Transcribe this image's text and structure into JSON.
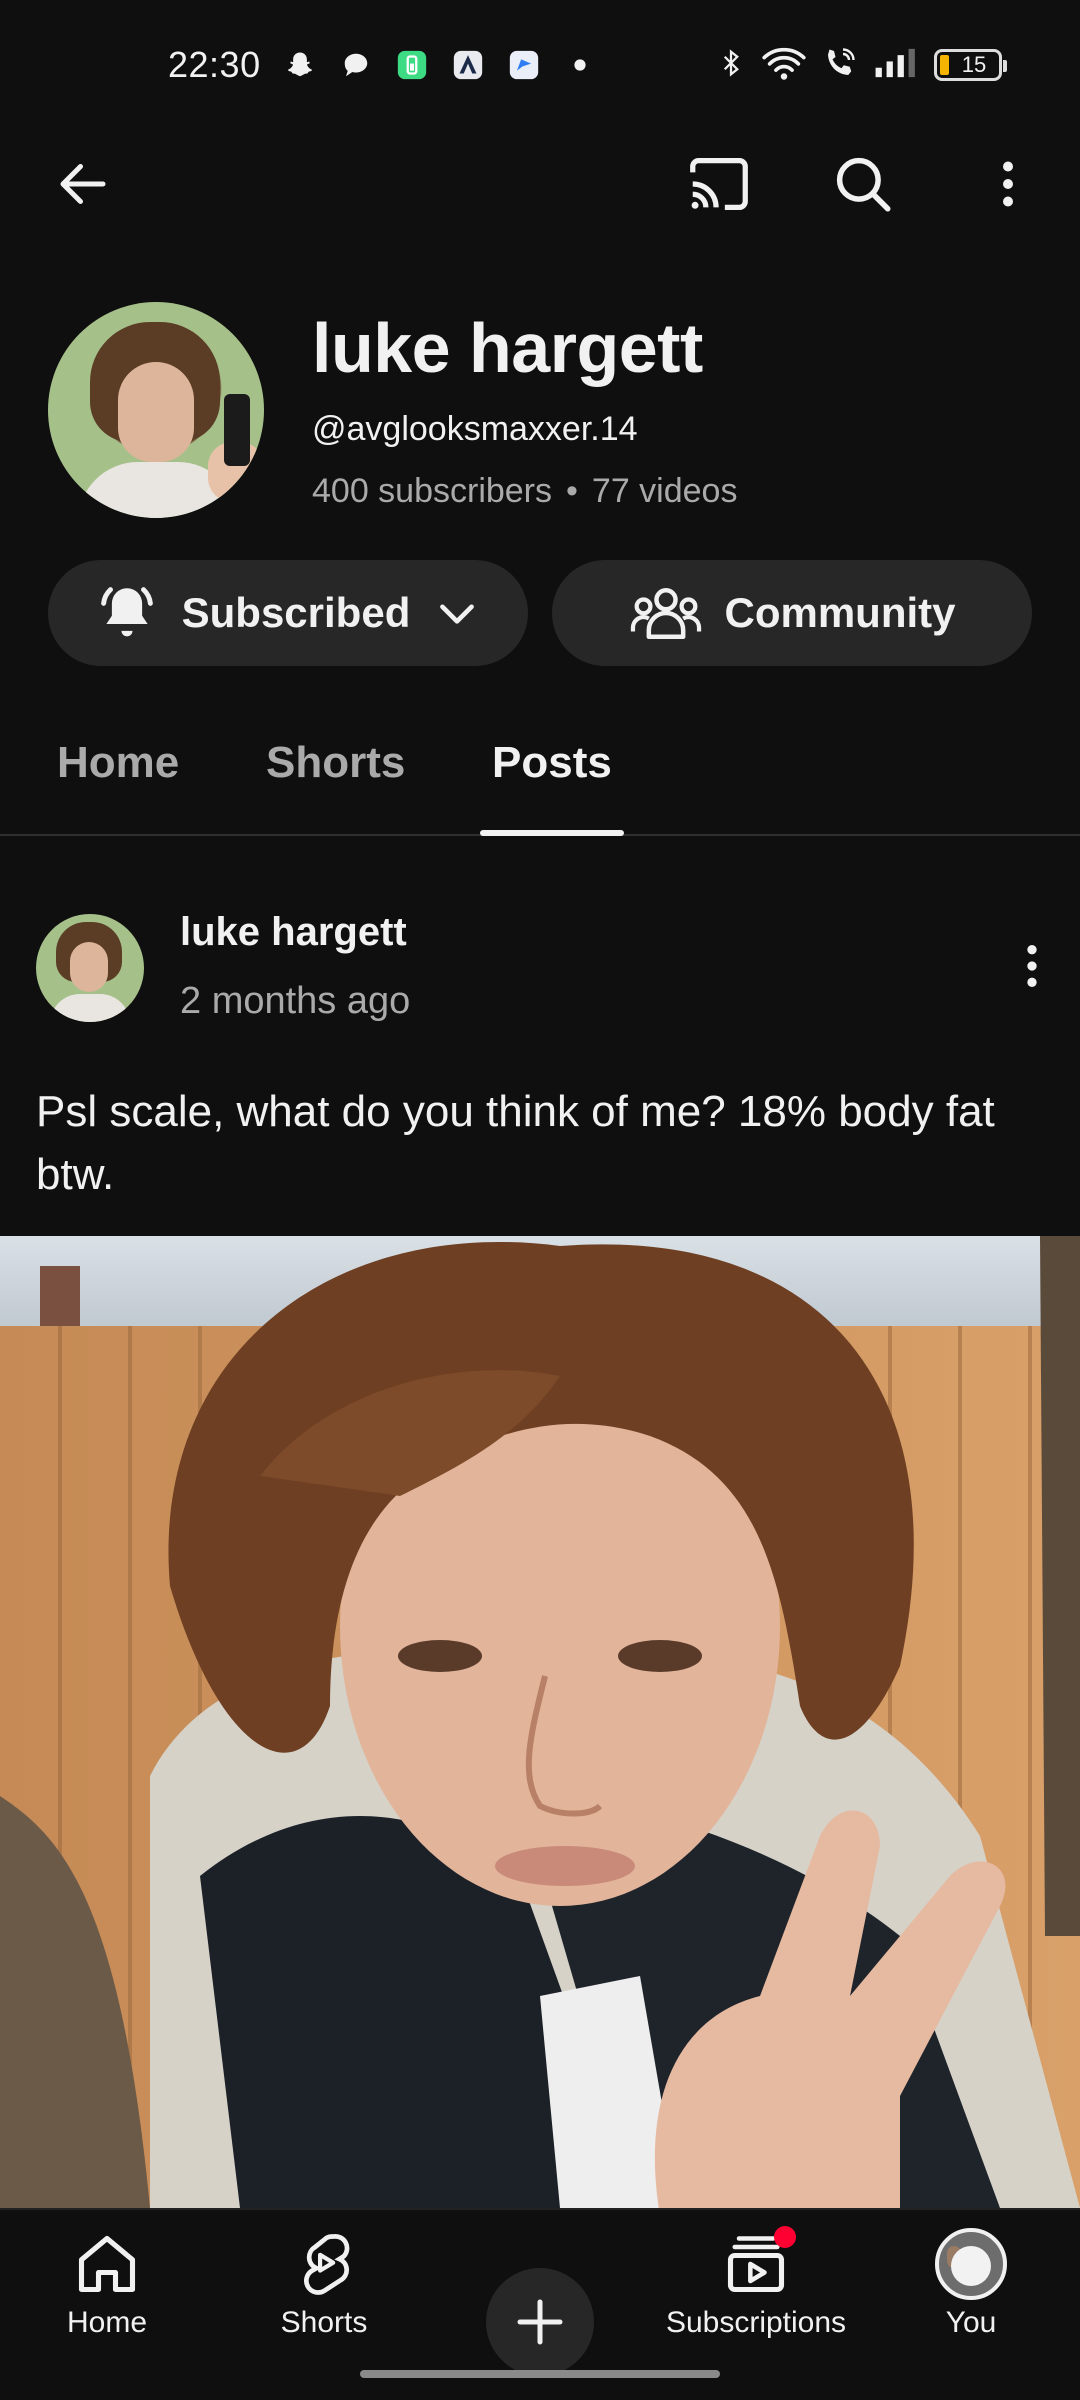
{
  "status_bar": {
    "time": "22:30",
    "battery_level": "15",
    "notification_icons": [
      "snapchat-icon",
      "chat-bubble-icon",
      "phone-battery-app-icon",
      "artstudio-icon",
      "messenger-app-icon",
      "more-notifications-dot-icon"
    ],
    "system_icons": [
      "bluetooth-icon",
      "wifi-icon",
      "wifi-calling-icon",
      "signal-icon",
      "battery-icon"
    ]
  },
  "app_bar": {
    "back_icon": "arrow-left-icon",
    "actions": [
      "cast-icon",
      "search-icon",
      "more-vert-icon"
    ]
  },
  "channel": {
    "name": "luke hargett",
    "handle": "@avglooksmaxxer.14",
    "subscribers": "400 subscribers",
    "separator": "•",
    "videos": "77 videos"
  },
  "actions": {
    "subscribed_label": "Subscribed",
    "community_label": "Community"
  },
  "tabs": [
    {
      "label": "Home",
      "active": false
    },
    {
      "label": "Shorts",
      "active": false
    },
    {
      "label": "Posts",
      "active": true
    }
  ],
  "post": {
    "author": "luke hargett",
    "time": "2 months ago",
    "text": "Psl scale, what do you think of me? 18% body fat btw.",
    "image_alt": "selfie photo"
  },
  "bottom_nav": {
    "home_label": "Home",
    "shorts_label": "Shorts",
    "create_icon": "plus-icon",
    "subscriptions_label": "Subscriptions",
    "you_label": "You",
    "subscriptions_has_new": true
  },
  "colors": {
    "background": "#0f0f0f",
    "surface": "#272727",
    "text_primary": "#f1f1f1",
    "text_secondary": "#aaaaaa",
    "accent_red": "#ff0033"
  }
}
